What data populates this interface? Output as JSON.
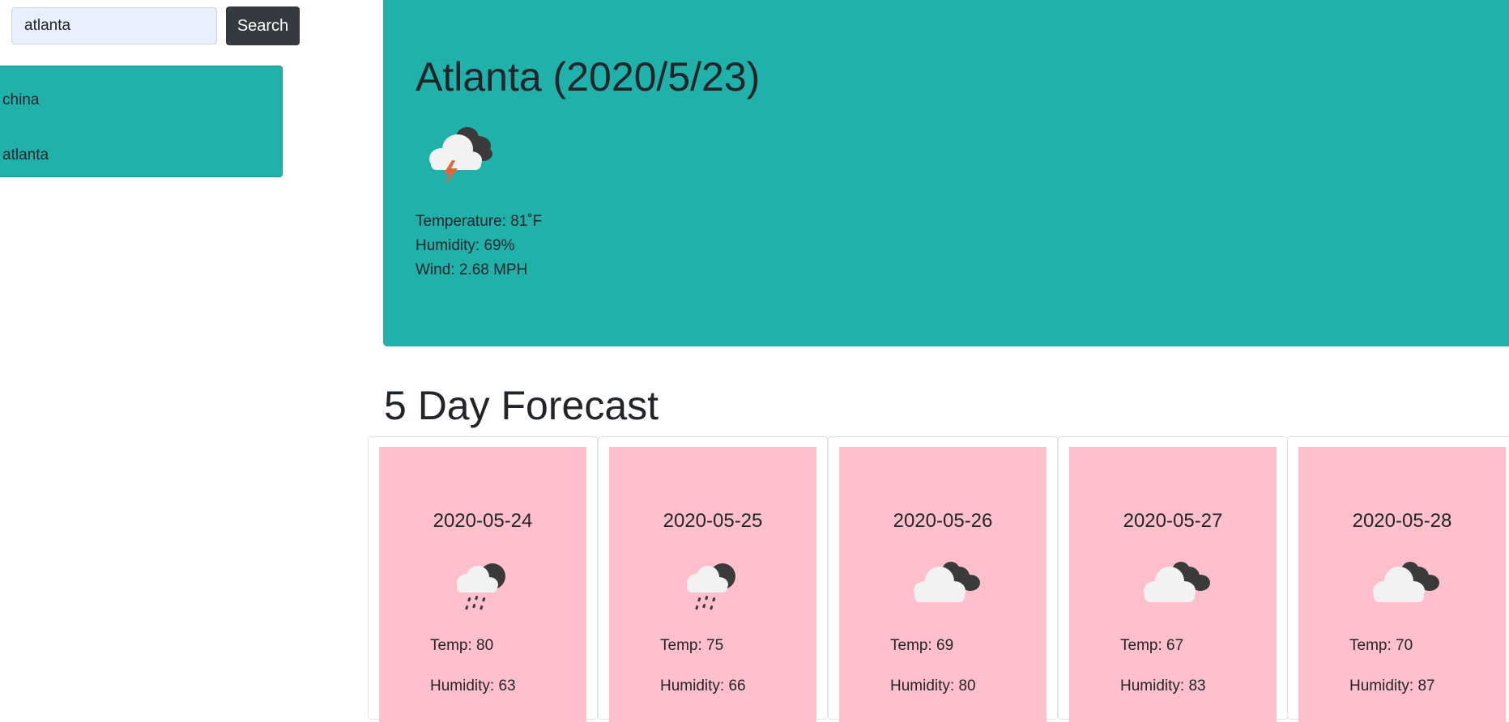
{
  "search": {
    "value": "atlanta",
    "button_label": "Search"
  },
  "history": {
    "items": [
      "china",
      "atlanta"
    ]
  },
  "current": {
    "title": "Atlanta (2020/5/23)",
    "icon": "thunderstorm-icon",
    "temperature": "Temperature: 81˚F",
    "humidity": "Humidity: 69%",
    "wind": "Wind: 2.68 MPH"
  },
  "forecast": {
    "title": "5 Day Forecast",
    "days": [
      {
        "date": "2020-05-24",
        "icon": "rain-icon",
        "temp": "Temp: 80",
        "humidity": "Humidity: 63"
      },
      {
        "date": "2020-05-25",
        "icon": "rain-icon",
        "temp": "Temp: 75",
        "humidity": "Humidity: 66"
      },
      {
        "date": "2020-05-26",
        "icon": "cloudy-icon",
        "temp": "Temp: 69",
        "humidity": "Humidity: 80"
      },
      {
        "date": "2020-05-27",
        "icon": "cloudy-icon",
        "temp": "Temp: 67",
        "humidity": "Humidity: 83"
      },
      {
        "date": "2020-05-28",
        "icon": "cloudy-icon",
        "temp": "Temp: 70",
        "humidity": "Humidity: 87"
      }
    ]
  },
  "colors": {
    "teal": "#20b2aa",
    "pink": "#ffc0cb",
    "dark": "#343a40"
  }
}
